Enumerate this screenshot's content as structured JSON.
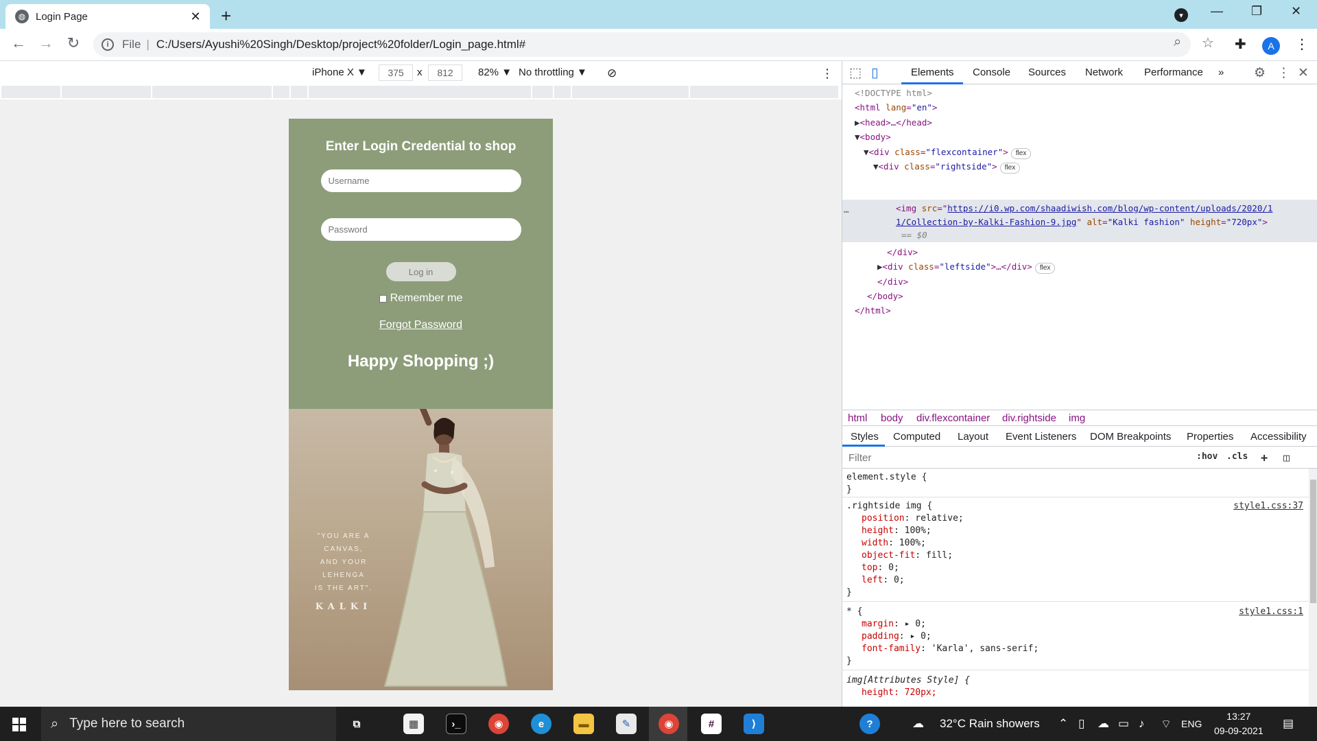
{
  "browser": {
    "tab_title": "Login Page",
    "tab_close": "✕",
    "new_tab": "+",
    "address": {
      "scheme_label": "File",
      "url": "C:/Users/Ayushi%20Singh/Desktop/project%20folder/Login_page.html#"
    },
    "profile_initial": "A",
    "window_controls": [
      "—",
      "❐",
      "✕"
    ]
  },
  "device_toolbar": {
    "device": "iPhone X ▼",
    "width": "375",
    "times": "x",
    "height": "812",
    "zoom": "82% ▼",
    "throttling": "No throttling ▼"
  },
  "login_page": {
    "heading": "Enter Login Credential to shop",
    "username_placeholder": "Username",
    "password_placeholder": "Password",
    "login_button": "Log in",
    "remember_me": "Remember me",
    "forgot_password": "Forgot Password",
    "happy_text": "Happy Shopping ;)",
    "panel_color": "#8d9d7a",
    "image_quote": [
      "\"YOU ARE A CANVAS,",
      "AND YOUR LEHENGA",
      "IS THE ART\"."
    ],
    "image_brand": "KALKI"
  },
  "devtools": {
    "tabs": [
      "Elements",
      "Console",
      "Sources",
      "Network",
      "Performance",
      "»"
    ],
    "active_tab": "Elements",
    "dom": {
      "doctype": "<!DOCTYPE html>",
      "html_open": "<html",
      "lang_attr": "lang",
      "lang_val": "\"en\"",
      "head": "<head>…</head>",
      "body_open": "<body>",
      "flexcontainer_open": "<div",
      "class_attr": "class",
      "flexcontainer_val": "\"flexcontainer\"",
      "rightside_val": "\"rightside\"",
      "img_open": "<img",
      "src_attr": "src",
      "src_val_1": "https://i0.wp.com/shaadiwish.com/blog/wp-content/uploads/2020/1",
      "src_val_2": "1/Collection-by-Kalki-Fashion-9.jpg",
      "alt_attr": "alt",
      "alt_val": "\"Kalki fashion\"",
      "height_attr": "height",
      "height_val": "\"720px\"",
      "eq_ref": "== $0",
      "div_close": "</div>",
      "leftside_val": "\"leftside\"",
      "leftside_rest": ">…</div>",
      "body_close": "</body>",
      "html_close": "</html>",
      "flex_badge": "flex",
      "dots": "…"
    },
    "breadcrumbs": [
      "html",
      "body",
      "div.flexcontainer",
      "div.rightside",
      "img"
    ],
    "subtabs": [
      "Styles",
      "Computed",
      "Layout",
      "Event Listeners",
      "DOM Breakpoints",
      "Properties",
      "Accessibility"
    ],
    "active_subtab": "Styles",
    "filter_placeholder": "Filter",
    "filter_tools": [
      ":hov",
      ".cls",
      "+"
    ],
    "rules": {
      "element_style": "element.style {",
      "close": "}",
      "rightside_selector": ".rightside img {",
      "rightside_source": "style1.css:37",
      "rightside_decls": [
        {
          "prop": "position",
          "val": "relative;"
        },
        {
          "prop": "height",
          "val": "100%;"
        },
        {
          "prop": "width",
          "val": "100%;"
        },
        {
          "prop": "object-fit",
          "val": "fill;"
        },
        {
          "prop": "top",
          "val": "0;"
        },
        {
          "prop": "left",
          "val": "0;"
        }
      ],
      "universal_selector": "* {",
      "universal_source": "style1.css:1",
      "universal_decls": [
        {
          "prop": "margin",
          "val": "▸ 0;"
        },
        {
          "prop": "padding",
          "val": "▸ 0;"
        },
        {
          "prop": "font-family",
          "val": "'Karla', sans-serif;"
        }
      ],
      "attr_selector": "img[Attributes Style] {",
      "attr_partial": "height: 720px;"
    }
  },
  "taskbar": {
    "search_placeholder": "Type here to search",
    "weather": "32°C  Rain showers",
    "language": "ENG",
    "time": "13:27",
    "date": "09-09-2021"
  }
}
